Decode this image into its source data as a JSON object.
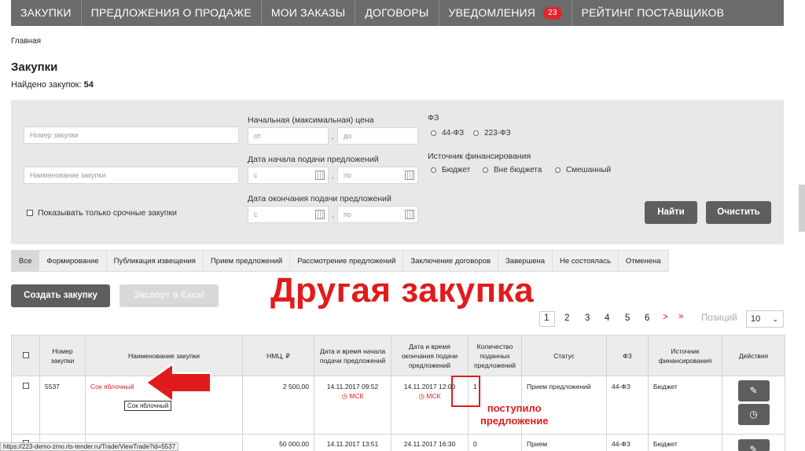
{
  "nav": {
    "items": [
      "Закупки",
      "Предложения о продаже",
      "Мои заказы",
      "Договоры",
      "Уведомления",
      "Рейтинг поставщиков"
    ],
    "notifications_count": "23"
  },
  "breadcrumb": "Главная",
  "page": {
    "title": "Закупки",
    "found_label": "Найдено закупок:",
    "found_count": "54"
  },
  "filters": {
    "number_placeholder": "Номер закупки",
    "name_placeholder": "Наименование закупки",
    "price_label": "Начальная (максимальная) цена",
    "price_from": "от",
    "price_to": "до",
    "start_label": "Дата начала подачи предложений",
    "start_from": "с",
    "start_to": "по",
    "end_label": "Дата окончания подачи предложений",
    "end_from": "с",
    "end_to": "по",
    "urgent_label": "Показывать только срочные закупки",
    "fz_label": "ФЗ",
    "fz_options": [
      "44-ФЗ",
      "223-ФЗ"
    ],
    "funding_label": "Источник финансирования",
    "funding_options": [
      "Бюджет",
      "Вне бюджета",
      "Смешанный"
    ],
    "search_button": "Найти",
    "clear_button": "Очистить"
  },
  "tabs": [
    "Все",
    "Формирование",
    "Публикация извещения",
    "Прием предложений",
    "Рассмотрение предложений",
    "Заключение договоров",
    "Завершена",
    "Не состоялась",
    "Отменена"
  ],
  "actions": {
    "create_button": "Создать закупку",
    "export_button": "Экспорт в Excel"
  },
  "big_caption": "Другая закупка",
  "pagination": {
    "pages": [
      "1",
      "2",
      "3",
      "4",
      "5",
      "6"
    ],
    "next": ">",
    "last": "»",
    "position_label": "Позиций",
    "page_size": "10"
  },
  "table": {
    "headers": [
      "Номер закупки",
      "Наименование закупки",
      "НМЦ, ₽",
      "Дата и время начала подачи предложений",
      "Дата и время окончания подачи предложений",
      "Количество поданных предложений",
      "Статус",
      "ФЗ",
      "Источник финансирования",
      "Действия"
    ],
    "rows": [
      {
        "number": "5537",
        "name": "Сок яблочный",
        "price": "2 500,00",
        "start_date": "14.11.2017 09:52",
        "start_tz": "МСК",
        "end_date": "14.11.2017 12:00",
        "end_tz": "МСК",
        "offers": "1",
        "status": "Прием предложений",
        "fz": "44-ФЗ",
        "funding": "Бюджет"
      },
      {
        "number": "",
        "name": "",
        "price": "50 000,00",
        "start_date": "14.11.2017 13:51",
        "start_tz": "",
        "end_date": "24.11.2017 16:30",
        "end_tz": "",
        "offers": "0",
        "status": "Прием",
        "fz": "44-ФЗ",
        "funding": "Бюджет"
      }
    ]
  },
  "tooltip": "Сок яблочный",
  "annotation_line1": "поступило",
  "annotation_line2": "предложение",
  "status_url": "https://223-demo-zmo.rts-tender.ru/Trade/ViewTrade?id=5537",
  "colors": {
    "accent_red": "#e11b1b",
    "nav_bg": "#6b6b6b",
    "panel_bg": "#e8e8e8",
    "button_dark": "#5e5e5e"
  }
}
